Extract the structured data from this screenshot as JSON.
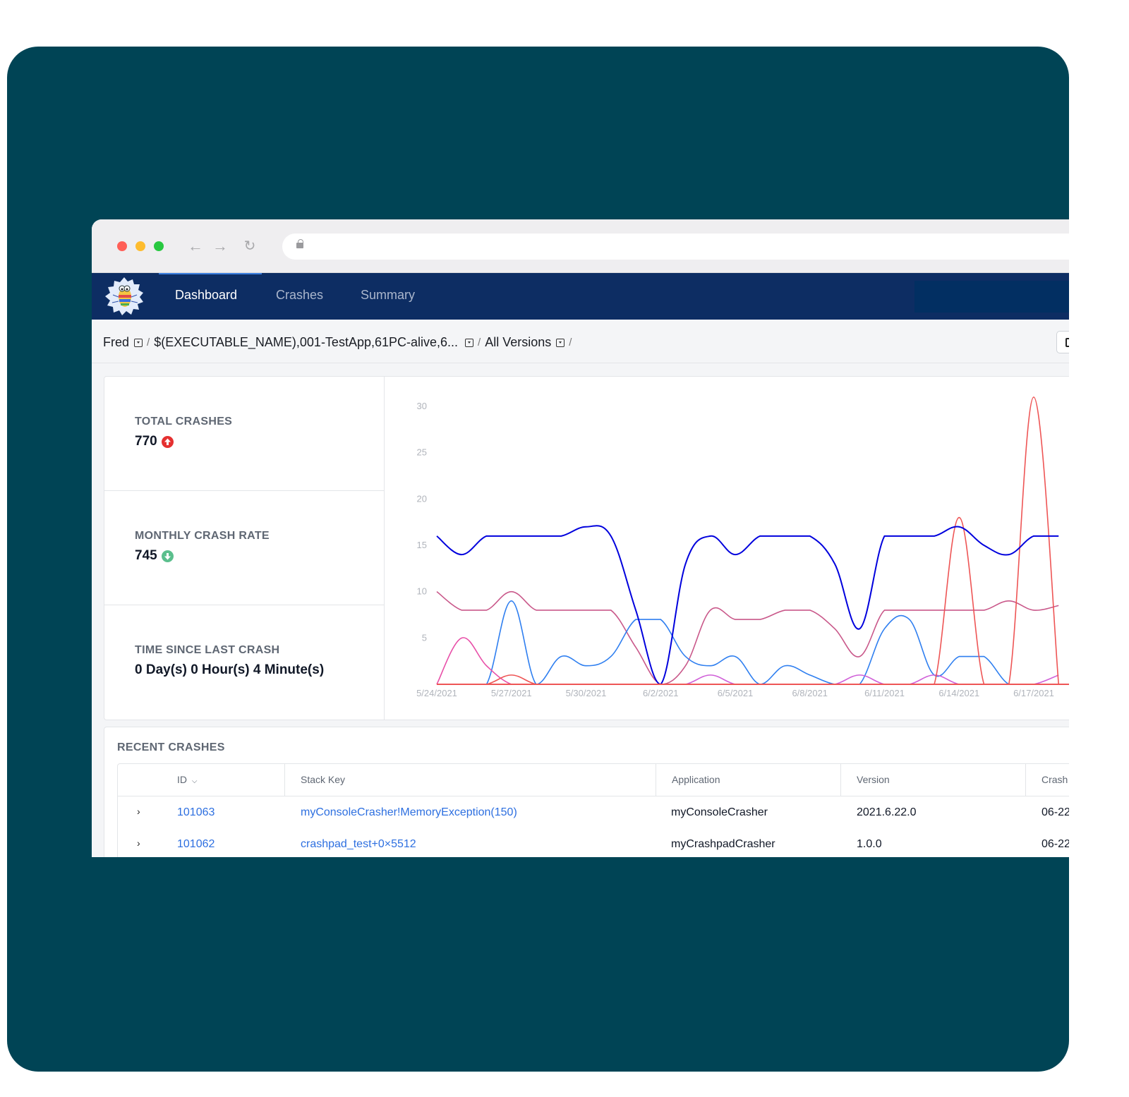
{
  "nav": {
    "items": [
      {
        "label": "Dashboard",
        "active": true
      },
      {
        "label": "Crashes",
        "active": false
      },
      {
        "label": "Summary",
        "active": false
      }
    ]
  },
  "breadcrumb": {
    "items": [
      "Fred",
      "$(EXECUTABLE_NAME),001-TestApp,61PC-alive,6...",
      "All Versions"
    ],
    "separator": "/"
  },
  "stats": [
    {
      "label": "TOTAL CRASHES",
      "value": "770",
      "trend": "up"
    },
    {
      "label": "MONTHLY CRASH RATE",
      "value": "745",
      "trend": "down"
    },
    {
      "label": "TIME SINCE LAST CRASH",
      "value": "0 Day(s) 0 Hour(s) 4 Minute(s)",
      "trend": null
    }
  ],
  "colors": {
    "nav_bg": "#0d2d63",
    "link": "#2d6fe0",
    "trend_up": "#e53030",
    "trend_down": "#5bbf8d"
  },
  "chart_data": {
    "type": "line",
    "title": "",
    "xlabel": "",
    "ylabel": "",
    "ylim": [
      0,
      30
    ],
    "yticks": [
      5,
      10,
      15,
      20,
      25,
      30
    ],
    "x": [
      "5/24/2021",
      "5/25/2021",
      "5/26/2021",
      "5/27/2021",
      "5/28/2021",
      "5/29/2021",
      "5/30/2021",
      "5/31/2021",
      "6/1/2021",
      "6/2/2021",
      "6/3/2021",
      "6/4/2021",
      "6/5/2021",
      "6/6/2021",
      "6/7/2021",
      "6/8/2021",
      "6/9/2021",
      "6/10/2021",
      "6/11/2021",
      "6/12/2021",
      "6/13/2021",
      "6/14/2021",
      "6/15/2021",
      "6/16/2021",
      "6/17/2021",
      "6/18/2021"
    ],
    "xtick_labels": [
      "5/24/2021",
      "5/27/2021",
      "5/30/2021",
      "6/2/2021",
      "6/5/2021",
      "6/8/2021",
      "6/11/2021",
      "6/14/2021",
      "6/17/2021"
    ],
    "grid": false,
    "legend": "none",
    "series": [
      {
        "name": "series-mauve",
        "color": "#c9588a",
        "values": [
          10,
          8,
          8,
          10,
          8,
          8,
          8,
          8,
          4,
          0,
          2,
          8,
          7,
          7,
          8,
          8,
          6,
          3,
          8,
          8,
          8,
          8,
          8,
          9,
          8,
          8.5
        ]
      },
      {
        "name": "series-lightblue",
        "color": "#2f7ff0",
        "values": [
          0,
          0,
          0,
          9,
          0,
          3,
          2,
          3,
          7,
          7,
          3,
          2,
          3,
          0,
          2,
          1,
          0,
          0,
          6,
          7,
          1,
          3,
          3,
          0,
          0,
          0
        ]
      },
      {
        "name": "series-pink",
        "color": "#e84fa8",
        "values": [
          0,
          5,
          2,
          0,
          0,
          0,
          0,
          0,
          0,
          0,
          0,
          0,
          0,
          0,
          0,
          0,
          0,
          0,
          0,
          0,
          0,
          0,
          0,
          0,
          0,
          0
        ]
      },
      {
        "name": "series-violet",
        "color": "#d060d8",
        "values": [
          0,
          0,
          0,
          0,
          0,
          0,
          0,
          0,
          0,
          0,
          0,
          1,
          0,
          0,
          0,
          0,
          0,
          1,
          0,
          0,
          1,
          0,
          0,
          0,
          0,
          1
        ]
      },
      {
        "name": "series-red",
        "color": "#ee5555",
        "values": [
          0,
          0,
          0,
          1,
          0,
          0,
          0,
          0,
          0,
          0,
          0,
          0,
          0,
          0,
          0,
          0,
          0,
          0,
          0,
          0,
          0,
          18,
          0,
          0,
          31,
          0
        ]
      },
      {
        "name": "series-darkblue",
        "color": "#0000dd",
        "values": [
          16,
          14,
          16,
          16,
          16,
          16,
          17,
          16,
          8,
          0,
          13,
          16,
          14,
          16,
          16,
          16,
          13,
          6,
          16,
          16,
          16,
          17,
          15,
          14,
          16,
          16
        ]
      }
    ]
  },
  "recent_crashes": {
    "title": "RECENT CRASHES",
    "columns": [
      "ID",
      "Stack Key",
      "Application",
      "Version",
      "Crash"
    ],
    "rows": [
      {
        "id": "101063",
        "stack_key": "myConsoleCrasher!MemoryException(150)",
        "application": "myConsoleCrasher",
        "version": "2021.6.22.0",
        "crash": "06-22"
      },
      {
        "id": "101062",
        "stack_key": "crashpad_test+0×5512",
        "application": "myCrashpadCrasher",
        "version": "1.0.0",
        "crash": "06-22"
      }
    ]
  }
}
